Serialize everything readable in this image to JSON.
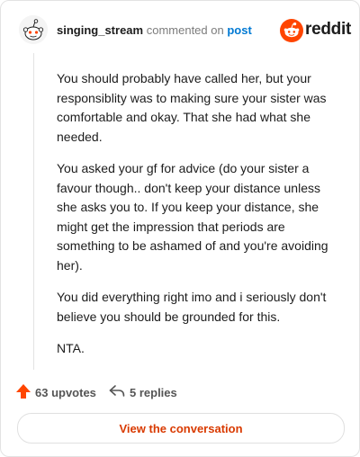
{
  "header": {
    "username": "singing_stream",
    "commented_text": "commented on",
    "post_link": "post",
    "brand": "reddit"
  },
  "comment": {
    "paragraphs": [
      "You should probably have called her, but your responsiblity was to making sure your sister was comfortable and okay. That she had what she needed.",
      "You asked your gf for advice (do your sister a favour though.. don't keep your distance unless she asks you to. If you keep your distance, she might get the impression that periods are something to be ashamed of and you're avoiding her).",
      "You did everything right imo and i seriously don't believe you should be grounded for this.",
      "NTA."
    ]
  },
  "footer": {
    "upvotes": "63 upvotes",
    "replies": "5 replies"
  },
  "cta": {
    "label": "View the conversation"
  },
  "colors": {
    "reddit_orange": "#ff4500",
    "upvote_orange": "#ff4500",
    "cta_text": "#d93a00",
    "link_blue": "#0079d3"
  },
  "icons": [
    "snoo-avatar-icon",
    "reddit-logo-icon",
    "upvote-arrow-icon",
    "reply-arrow-icon"
  ]
}
